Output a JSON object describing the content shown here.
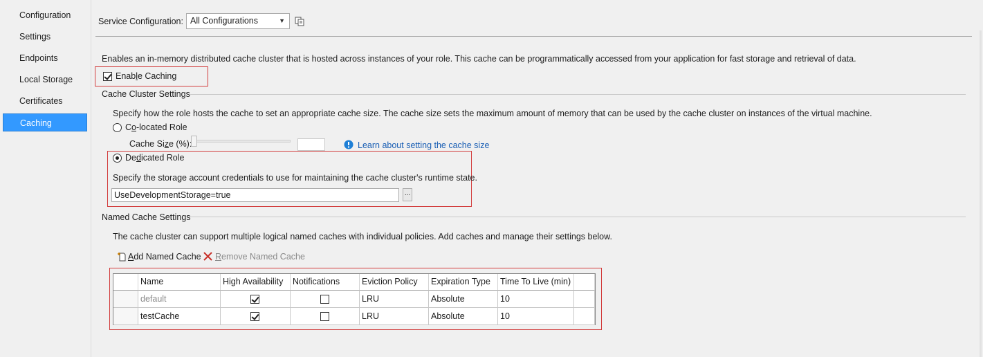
{
  "nav": {
    "items": [
      {
        "label": "Configuration"
      },
      {
        "label": "Settings"
      },
      {
        "label": "Endpoints"
      },
      {
        "label": "Local Storage"
      },
      {
        "label": "Certificates"
      },
      {
        "label": "Caching",
        "selected": true
      }
    ]
  },
  "service_config": {
    "label": "Service Configuration:",
    "value": "All Configurations",
    "manage_icon": "copy-config-icon"
  },
  "description": "Enables an in-memory distributed cache cluster that is hosted across instances of your role. This cache can be programmatically accessed from your application for fast storage and retrieval of data.",
  "enable_caching": {
    "pre": "Enab",
    "key": "l",
    "post": "e Caching",
    "checked": true
  },
  "cluster": {
    "title": "Cache Cluster Settings",
    "description": "Specify how the role hosts the cache to set an appropriate cache size. The cache size sets the maximum amount of memory that can be used by the cache cluster on instances of the virtual machine.",
    "colocated": {
      "pre": "C",
      "key": "o",
      "post": "-located Role",
      "selected": false
    },
    "cache_size": {
      "pre": "Cache Si",
      "key": "z",
      "post": "e (%):",
      "value": ""
    },
    "learn_link": "Learn about setting the cache size",
    "dedicated": {
      "pre": "De",
      "key": "d",
      "post": "icated Role",
      "selected": true
    },
    "storage_description": "Specify the storage account credentials to use for maintaining the cache cluster's runtime state.",
    "storage_value": "UseDevelopmentStorage=true",
    "browse_label": "..."
  },
  "named": {
    "title": "Named Cache Settings",
    "description": "The cache cluster can support multiple logical named caches with individual policies. Add caches and manage their settings below.",
    "add_key": "A",
    "add_rest": "dd Named Cache",
    "remove_key": "R",
    "remove_rest": "emove Named Cache",
    "columns": [
      "Name",
      "High Availability",
      "Notifications",
      "Eviction Policy",
      "Expiration Type",
      "Time To Live (min)"
    ],
    "rows": [
      {
        "name": "default",
        "high_availability": true,
        "notifications": false,
        "eviction": "LRU",
        "expiration": "Absolute",
        "ttl": "10"
      },
      {
        "name": "testCache",
        "high_availability": true,
        "notifications": false,
        "eviction": "LRU",
        "expiration": "Absolute",
        "ttl": "10"
      }
    ]
  },
  "colors": {
    "accent": "#3399ff",
    "highlight_box": "#d23b3b",
    "link": "#1a5fb4"
  }
}
